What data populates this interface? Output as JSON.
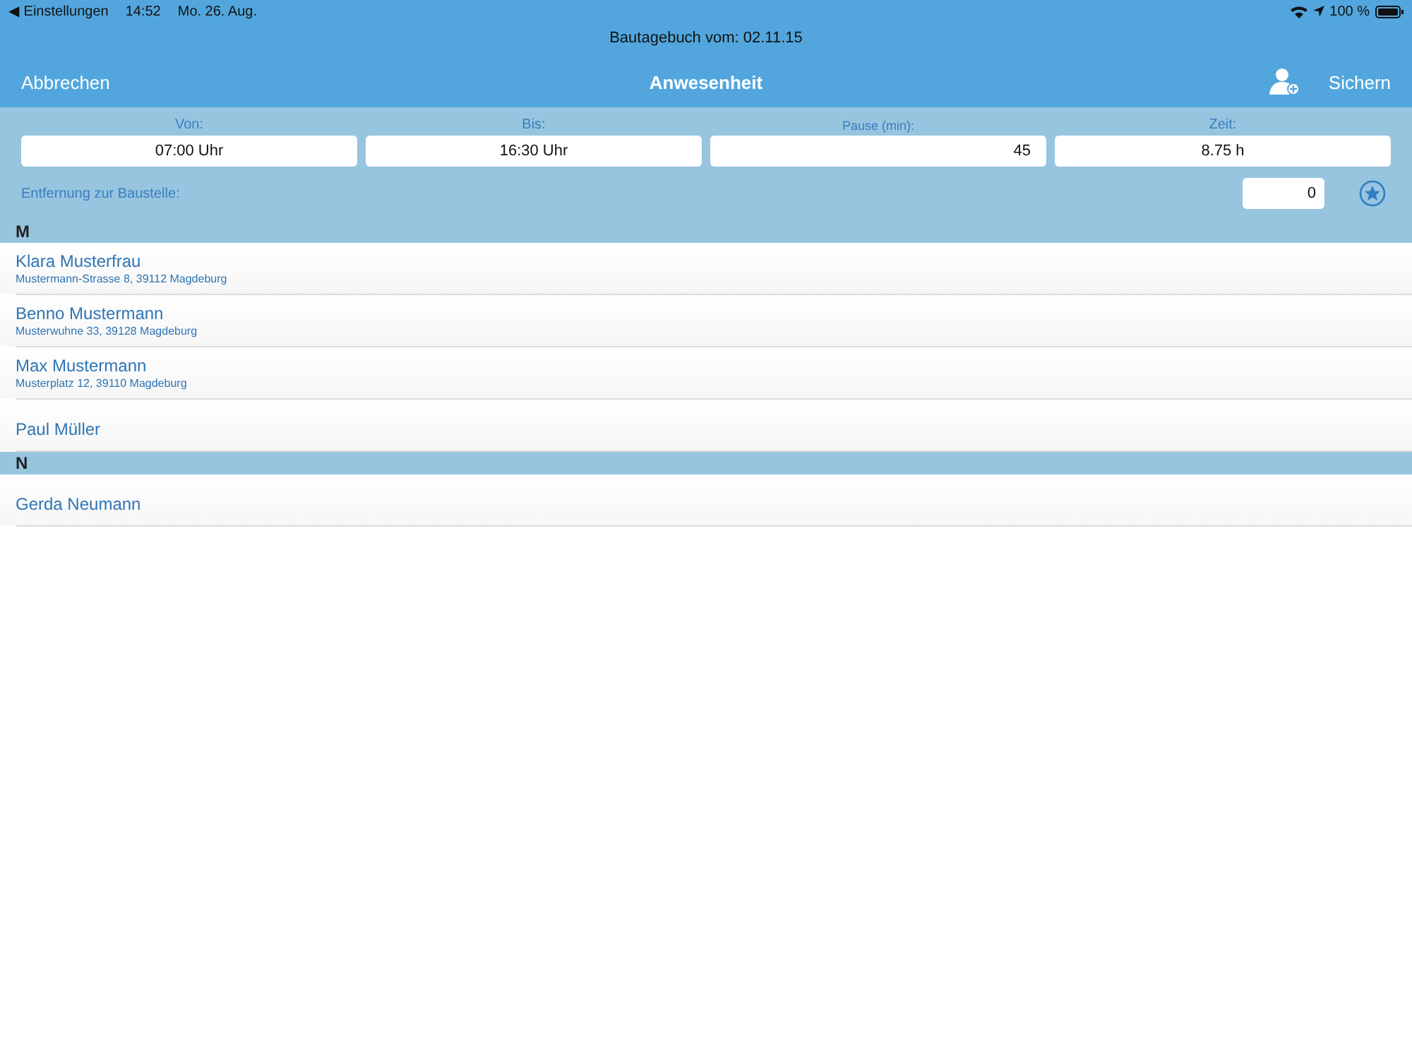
{
  "status_bar": {
    "back": "◀ Einstellungen",
    "time": "14:52",
    "date": "Mo. 26. Aug.",
    "battery": "100 %"
  },
  "subtitle": "Bautagebuch vom:  02.11.15",
  "nav": {
    "left": "Abbrechen",
    "title": "Anwesenheit",
    "right": "Sichern"
  },
  "times": [
    {
      "label": "Von:",
      "value": "07:00 Uhr",
      "kind": "time"
    },
    {
      "label": "Bis:",
      "value": "16:30 Uhr",
      "kind": "time"
    },
    {
      "label": "Pause (min):",
      "value": "45",
      "kind": "number"
    },
    {
      "label": "Zeit:",
      "value": "8.75 h",
      "kind": "time"
    }
  ],
  "distance": {
    "label": "Entfernung zur Baustelle:",
    "value": "0"
  },
  "sections": [
    {
      "letter": "M",
      "people": [
        {
          "name": "Klara Musterfrau",
          "address": "Mustermann-Strasse 8, 39112 Magdeburg"
        },
        {
          "name": "Benno Mustermann",
          "address": "Musterwuhne 33, 39128 Magdeburg"
        },
        {
          "name": "Max Mustermann",
          "address": "Musterplatz 12, 39110 Magdeburg"
        },
        {
          "name": "Paul Müller"
        }
      ]
    },
    {
      "letter": "N",
      "people": [
        {
          "name": "Gerda Neumann"
        }
      ]
    }
  ]
}
